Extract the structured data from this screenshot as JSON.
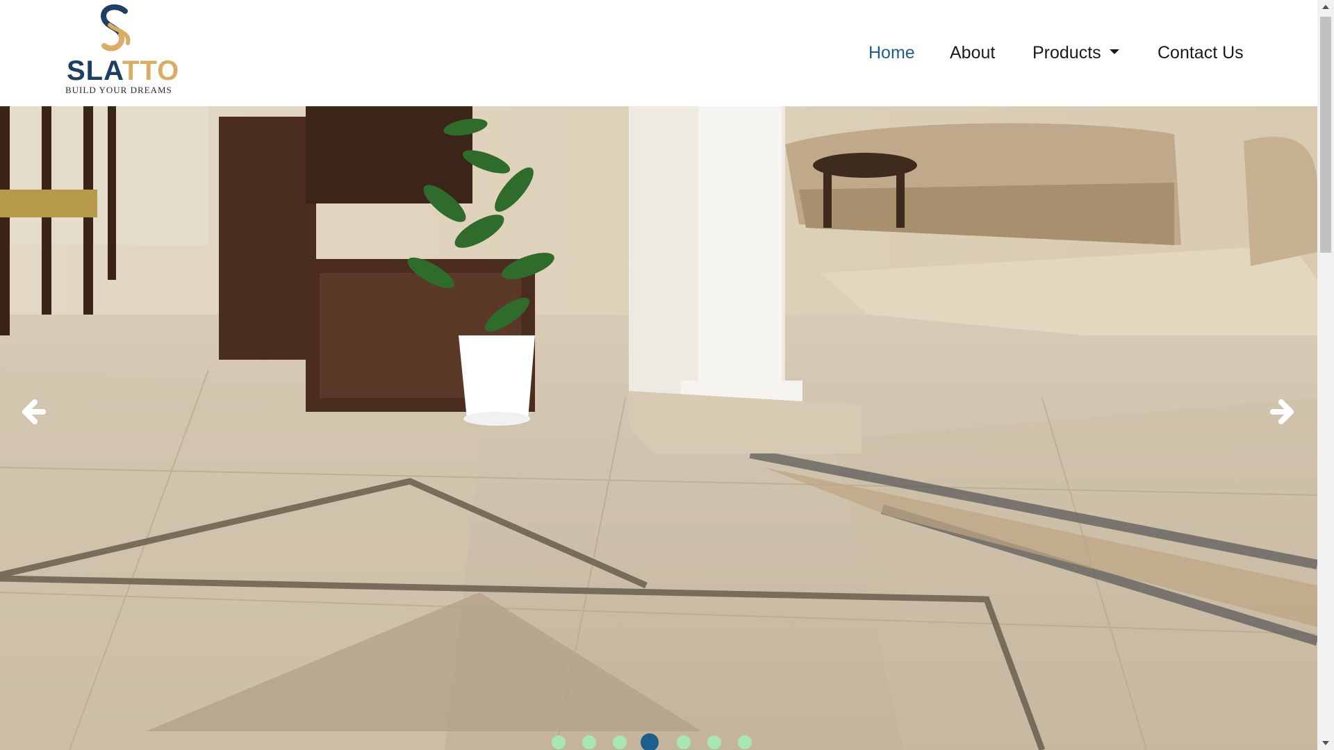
{
  "brand": {
    "name_part1": "SLA",
    "name_part2": "TTO",
    "tagline": "BUILD YOUR DREAMS",
    "colors": {
      "navy": "#1d3f63",
      "gold": "#d9ad63"
    }
  },
  "nav": {
    "items": [
      {
        "label": "Home",
        "active": true
      },
      {
        "label": "About",
        "active": false
      },
      {
        "label": "Products",
        "active": false,
        "dropdown": true
      },
      {
        "label": "Contact Us",
        "active": false
      }
    ],
    "active_color": "#1d5f8a"
  },
  "carousel": {
    "image_description_icon": "hero-slide-image",
    "prev_icon": "arrow-left-icon",
    "next_icon": "arrow-right-icon",
    "slide_count": 7,
    "active_index": 3,
    "indicator_color": "#a9e6b5",
    "active_indicator_color": "#1d5f8a"
  }
}
